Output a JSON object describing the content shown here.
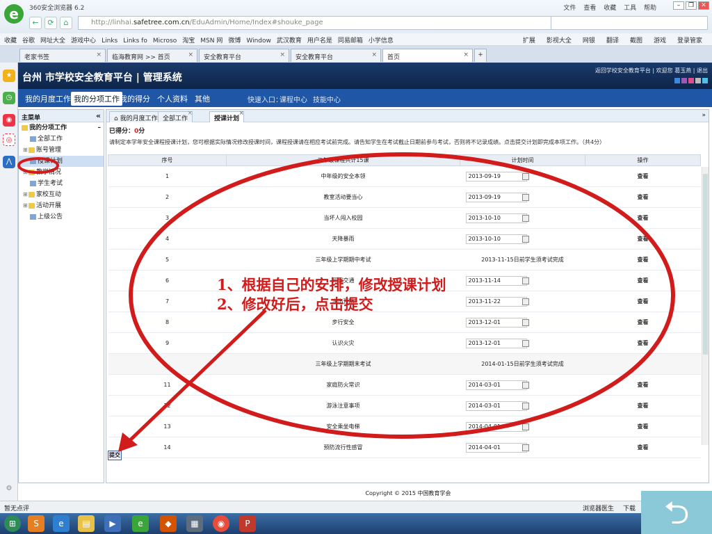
{
  "browser": {
    "name": "360安全浏览器 6.2",
    "url_prefix": "http://linhai.",
    "url_domain": "safetree.com.cn",
    "url_path": "/EduAdmin/Home/Index#shouke_page",
    "menu": [
      "文件",
      "查看",
      "收藏",
      "工具",
      "帮助"
    ]
  },
  "favorites": [
    "收藏",
    "谷歌",
    "网址大全",
    "游戏中心",
    "Links",
    "Links fo",
    "Microso",
    "淘宝",
    "MSN 网",
    "微博",
    "Window",
    "武汉教育",
    "用户名是",
    "同易邮箱",
    "小学信息"
  ],
  "favorites_right": [
    "扩展",
    "影视大全",
    "网银",
    "翻译",
    "截图",
    "游戏",
    "登录管家"
  ],
  "tabs": [
    {
      "label": "老家书签"
    },
    {
      "label": "临海教育网 >> 首页"
    },
    {
      "label": "安全教育平台"
    },
    {
      "label": "安全教育平台"
    },
    {
      "label": "首页"
    }
  ],
  "header": {
    "title": "台州 市学校安全教育平台 | 管理系统",
    "links": "返回学校安全教育平台 | 欢迎您 葛玉燕 | 退出"
  },
  "menu": {
    "items": [
      "我的月度工作",
      "我的分项工作",
      "我的得分",
      "个人资料",
      "其他"
    ],
    "quick": "快速入口：",
    "quick_links": [
      "课程中心",
      "技能中心"
    ]
  },
  "left": {
    "title": "主菜单",
    "section": "我的分项工作",
    "items": [
      {
        "label": "全部工作",
        "type": "doc"
      },
      {
        "label": "账号管理",
        "type": "folder"
      },
      {
        "label": "授课计划",
        "type": "doc"
      },
      {
        "label": "教学情况",
        "type": "folder"
      },
      {
        "label": "学生考试",
        "type": "doc"
      },
      {
        "label": "家校互动",
        "type": "folder"
      },
      {
        "label": "活动开展",
        "type": "folder"
      },
      {
        "label": "上级公告",
        "type": "doc"
      }
    ]
  },
  "main": {
    "tabs": [
      "我的月度工作",
      "全部工作",
      "授课计划"
    ],
    "score_label": "已得分：",
    "score_value": "0",
    "score_unit": "分",
    "note": "请制定本学年安全课程授课计划，您可根据实际情况修改授课时间，课程授课请在相应考试前完成。请告知学生在考试截止日期前参与考试，否则将不记录成绩。点击提交计划即完成本项工作。（共4分）",
    "columns": [
      "序号",
      "二年级课程共计15课",
      "计划时间",
      "操作"
    ],
    "rows": [
      {
        "no": "1",
        "name": "中年级的安全本领",
        "date": "2013-09-19",
        "op": "查看"
      },
      {
        "no": "2",
        "name": "教室活动要当心",
        "date": "2013-09-19",
        "op": "查看"
      },
      {
        "no": "3",
        "name": "当坏人闯入校园",
        "date": "2013-10-10",
        "op": "查看"
      },
      {
        "no": "4",
        "name": "天降暴雨",
        "date": "2013-10-10",
        "op": "查看"
      },
      {
        "no": "5",
        "name": "三年级上学期期中考试",
        "plain": "2013-11-15日前学生须考试完成",
        "op": "查看"
      },
      {
        "no": "6",
        "name": "开展交通",
        "date": "2013-11-14",
        "op": "查看"
      },
      {
        "no": "7",
        "name": "冻伤预防",
        "date": "2013-11-22",
        "op": "查看"
      },
      {
        "no": "8",
        "name": "步行安全",
        "date": "2013-12-01",
        "op": "查看"
      },
      {
        "no": "9",
        "name": "认识火灾",
        "date": "2013-12-01",
        "op": "查看"
      },
      {
        "no": "",
        "name": "三年级上学期期末考试",
        "plain": "2014-01-15日前学生须考试完成",
        "op": "",
        "alt": true
      },
      {
        "no": "11",
        "name": "家庭防火常识",
        "date": "2014-03-01",
        "op": "查看"
      },
      {
        "no": "12",
        "name": "游泳注意事项",
        "date": "2014-03-01",
        "op": "查看"
      },
      {
        "no": "13",
        "name": "安全乘坐电梯",
        "date": "2014-04-01",
        "op": "查看"
      },
      {
        "no": "14",
        "name": "预防流行性感冒",
        "date": "2014-04-01",
        "op": "查看"
      }
    ],
    "submit": "提交",
    "copyright": "Copyright © 2015 中国教育学会"
  },
  "status": {
    "left": "暂无点评",
    "right": [
      "浏览器医生",
      "下载"
    ]
  },
  "annotation": {
    "line1": "1、根据自己的安排，修改授课计划",
    "line2": "2、修改好后，点击提交"
  },
  "colors": {
    "accent": "#1f57a6",
    "annotation": "#d21b1b",
    "header": "#0d2448"
  }
}
